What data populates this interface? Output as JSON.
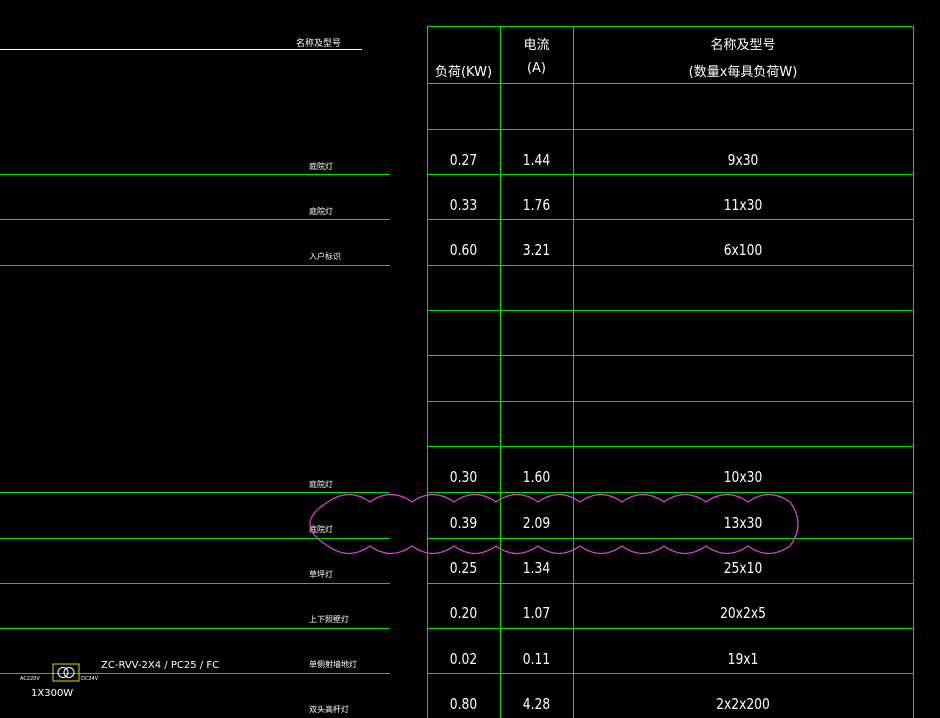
{
  "left": {
    "header": "名称及型号",
    "rows": [
      {
        "name": "庭院灯"
      },
      {
        "name": "庭院灯"
      },
      {
        "name": "入户标识"
      },
      {
        "name": "庭院灯"
      },
      {
        "name": "庭院灯"
      },
      {
        "name": "草坪灯"
      },
      {
        "name": "上下照壁灯"
      },
      {
        "name": "单侧射墙地灯"
      },
      {
        "name": "双头高杆灯"
      }
    ],
    "device": {
      "ac_label": "AC220V",
      "dc_label": "DC24V",
      "cable": "ZC-RVV-2X4 / PC25 / FC",
      "power": "1X300W"
    }
  },
  "table": {
    "headers": {
      "load_line2": "负荷(KW)",
      "current_line1": "电流",
      "current_line2": "(A)",
      "spec_line1": "名称及型号",
      "spec_line2": "(数量x每具负荷W)"
    },
    "rows": [
      {
        "load": "",
        "current": "",
        "spec": ""
      },
      {
        "load": "0.27",
        "current": "1.44",
        "spec": "9x30"
      },
      {
        "load": "0.33",
        "current": "1.76",
        "spec": "11x30"
      },
      {
        "load": "0.60",
        "current": "3.21",
        "spec": "6x100"
      },
      {
        "load": "",
        "current": "",
        "spec": ""
      },
      {
        "load": "",
        "current": "",
        "spec": ""
      },
      {
        "load": "",
        "current": "",
        "spec": ""
      },
      {
        "load": "",
        "current": "",
        "spec": ""
      },
      {
        "load": "0.30",
        "current": "1.60",
        "spec": "10x30"
      },
      {
        "load": "0.39",
        "current": "2.09",
        "spec": "13x30"
      },
      {
        "load": "0.25",
        "current": "1.34",
        "spec": "25x10"
      },
      {
        "load": "0.20",
        "current": "1.07",
        "spec": "20x2x5"
      },
      {
        "load": "0.02",
        "current": "0.11",
        "spec": "19x1"
      },
      {
        "load": "0.80",
        "current": "4.28",
        "spec": "2x2x200"
      }
    ]
  },
  "colors": {
    "background": "#000000",
    "grid": "#00e000",
    "text": "#ffffff",
    "revision_cloud": "#e040e0",
    "device": "#e0e000"
  }
}
